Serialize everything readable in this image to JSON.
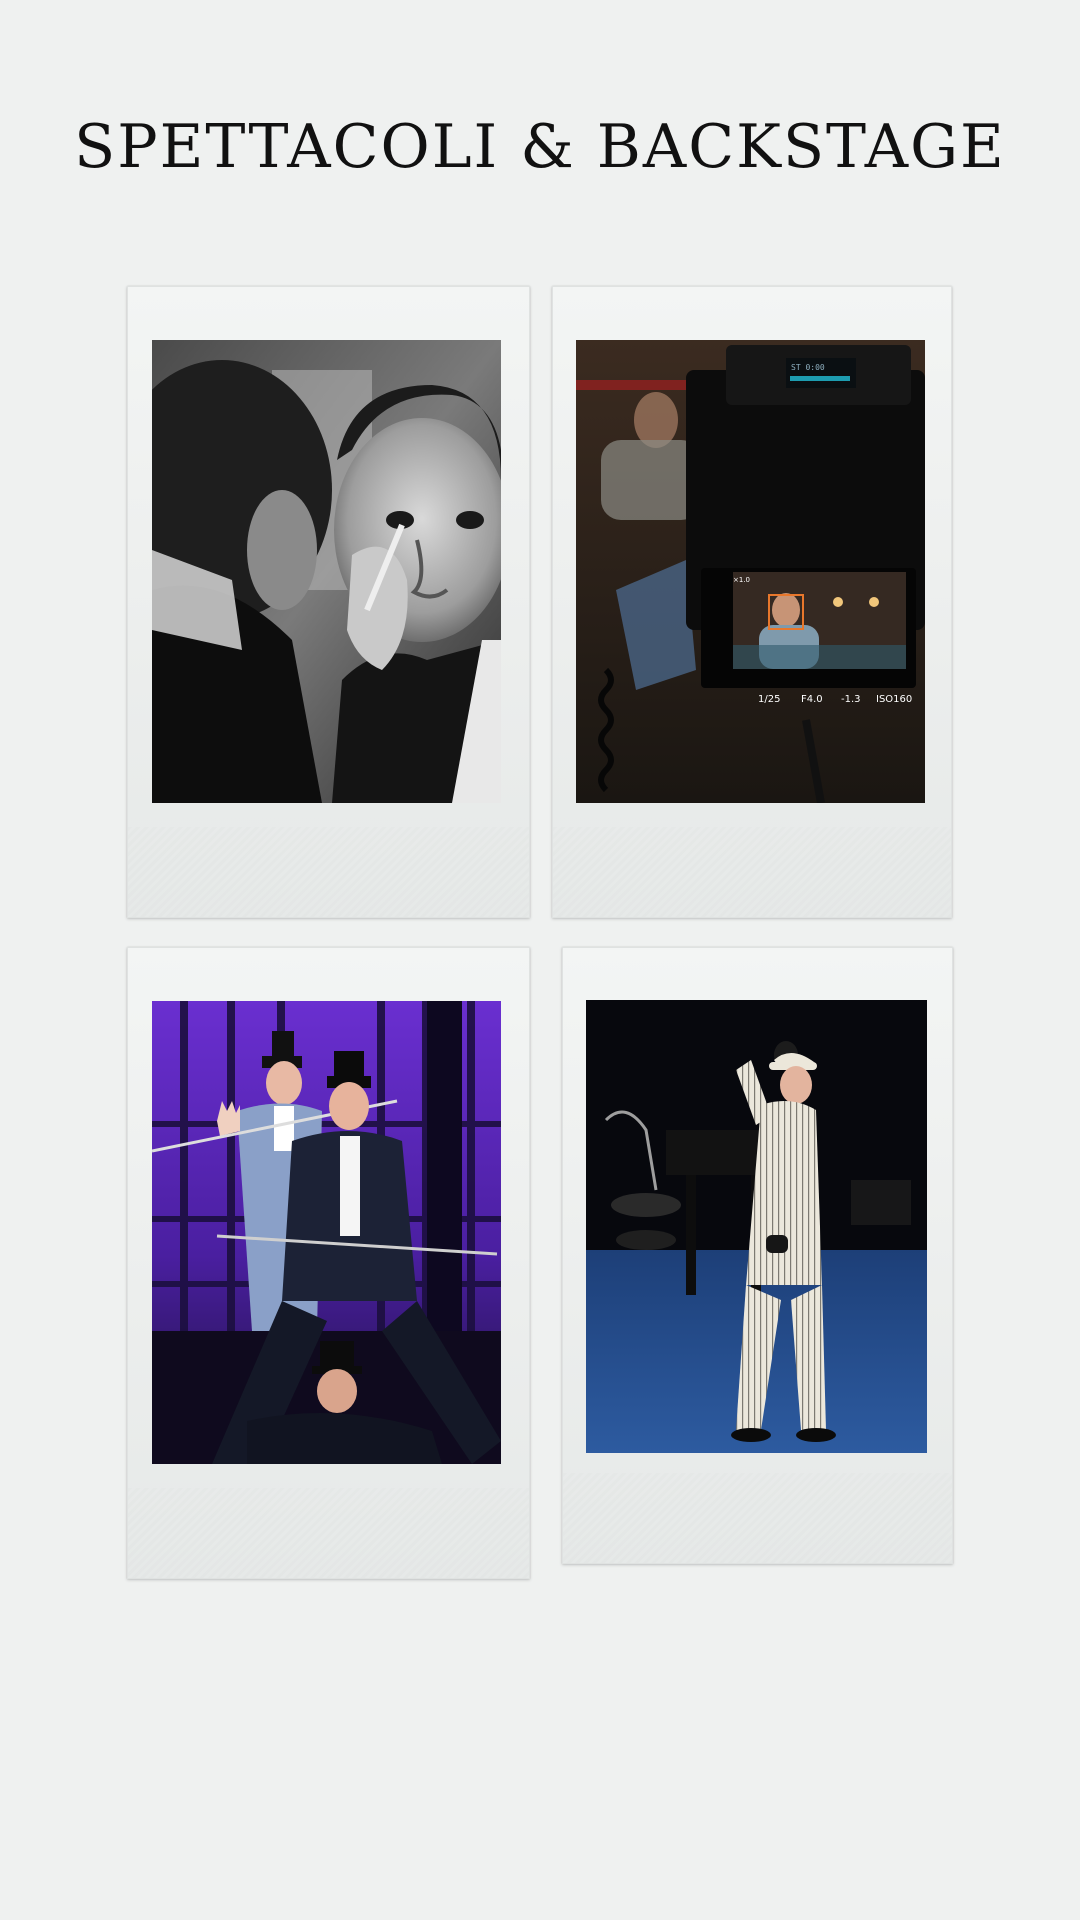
{
  "page": {
    "title": "SPETTACOLI & BACKSTAGE"
  },
  "photos": [
    {
      "subject": "makeup-mirror-black-and-white"
    },
    {
      "subject": "camera-viewfinder-interview"
    },
    {
      "subject": "top-hat-trio-purple-stage"
    },
    {
      "subject": "pinstripe-suit-performer-blue-stage"
    }
  ],
  "camera_screen": {
    "zoom": "×1.0",
    "status": "ST 0:00",
    "shutter": "1/25",
    "aperture": "F4.0",
    "exposure": "-1.3",
    "iso": "ISO160"
  },
  "colors": {
    "background": "#eff1f0",
    "frame": "#eceeed",
    "stage_purple": "#6a2fd0",
    "stage_blue": "#1d3f78"
  }
}
